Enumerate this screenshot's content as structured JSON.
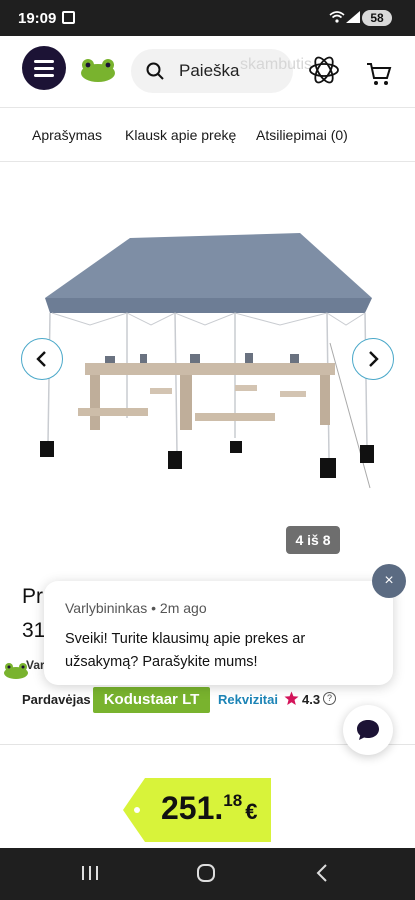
{
  "status_bar": {
    "time": "19:09",
    "battery": "58"
  },
  "header": {
    "search_placeholder": "Paieška",
    "ghost_text": "skambutis"
  },
  "tabs": [
    {
      "label": "Aprašymas"
    },
    {
      "label": "Klausk apie prekę"
    },
    {
      "label": "Atsiliepimai (0)"
    }
  ],
  "gallery": {
    "counter": "4 iš 8"
  },
  "product": {
    "title_fragment_1": "Pr",
    "title_fragment_2": "31",
    "vendor_fragment": "Var"
  },
  "seller": {
    "label": "Pardavėjas",
    "name": "Kodustaar LT",
    "details_link": "Rekvizitai",
    "rating": "4.3",
    "help": "?"
  },
  "price": {
    "main": "251.",
    "cents": "18",
    "currency": "€"
  },
  "chat": {
    "sender": "Varlybininkas",
    "time": "2m ago",
    "separator": " • ",
    "message": "Sveiki! Turite klausimų apie prekes ar užsakymą? Parašykite mums!",
    "close": "×"
  },
  "colors": {
    "brand_dark": "#1c1335",
    "brand_green": "#79b32e",
    "price_tag": "#d8f33a",
    "link_blue": "#1c84b6"
  }
}
